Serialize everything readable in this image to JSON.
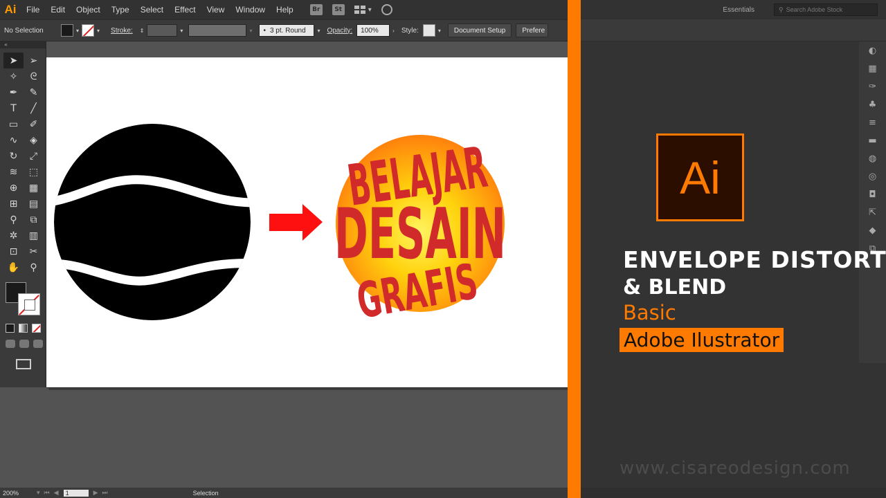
{
  "menubar": {
    "app_icon": "Ai",
    "items": [
      "File",
      "Edit",
      "Object",
      "Type",
      "Select",
      "Effect",
      "View",
      "Window",
      "Help"
    ],
    "bridge": "Br",
    "stock": "St"
  },
  "controlbar": {
    "selection": "No Selection",
    "stroke_label": "Stroke:",
    "brush": "3 pt. Round",
    "opacity_label": "Opacity:",
    "opacity_value": "100%",
    "style_label": "Style:",
    "doc_setup": "Document Setup",
    "preferences": "Prefere"
  },
  "right_top": {
    "workspace": "Essentials",
    "search_placeholder": "Search Adobe Stock"
  },
  "status": {
    "zoom": "200%",
    "page": "1",
    "mode": "Selection"
  },
  "artwork": {
    "text_lines": [
      "BELAJAR",
      "DESAIN",
      "GRAFIS"
    ],
    "colors": {
      "text": "#d12a2a",
      "glow_center": "#ffe000",
      "glow_edge": "#ff6a00",
      "arrow": "#ff1010"
    }
  },
  "promo": {
    "logo_text": "Ai",
    "title_line1": "ENVELOPE DISTORT",
    "title_line2": "& BLEND",
    "subtitle1": "Basic",
    "subtitle2": "Adobe Ilustrator",
    "website": "www.cisareodesign.com",
    "accent": "#ff7a00"
  }
}
